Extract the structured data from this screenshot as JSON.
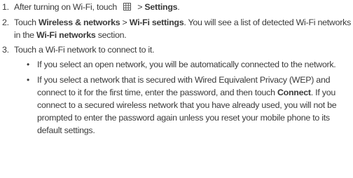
{
  "steps": [
    {
      "number": "1.",
      "text_before_icon": "After turning on Wi-Fi, touch",
      "icon": "grid-menu-icon",
      "text_after_icon": "> ",
      "bold_1": "Settings",
      "text_end": "."
    },
    {
      "number": "2.",
      "text_1": "Touch ",
      "bold_1": "Wireless & networks",
      "text_2": " > ",
      "bold_2": "Wi-Fi settings",
      "text_3": ". You will see a list of detected Wi-Fi networks in the ",
      "bold_3": "Wi-Fi networks",
      "text_4": " section."
    },
    {
      "number": "3.",
      "text": "Touch a Wi-Fi network to connect to it."
    }
  ],
  "bullets": [
    {
      "marker": "•",
      "text": "If you select an open network, you will be automatically connected to the network."
    },
    {
      "marker": "•",
      "text_1": "If you select a network that is secured with Wired Equivalent Privacy (WEP) and connect to it for the first time, enter the password, and then touch ",
      "bold_1": "Connect",
      "text_2": ". If you connect to a secured wireless network that you have already used, you will not be prompted to enter the password again unless you reset your mobile phone to its default settings."
    }
  ]
}
